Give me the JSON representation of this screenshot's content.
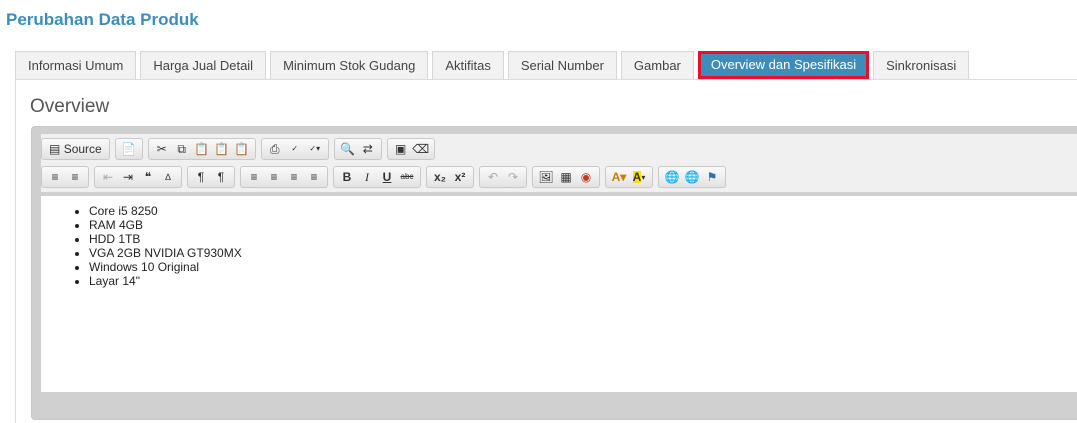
{
  "page": {
    "title": "Perubahan Data Produk"
  },
  "tabs": [
    {
      "label": "Informasi Umum",
      "active": false
    },
    {
      "label": "Harga Jual Detail",
      "active": false
    },
    {
      "label": "Minimum Stok Gudang",
      "active": false
    },
    {
      "label": "Aktifitas",
      "active": false
    },
    {
      "label": "Serial Number",
      "active": false
    },
    {
      "label": "Gambar",
      "active": false
    },
    {
      "label": "Overview dan Spesifikasi",
      "active": true
    },
    {
      "label": "Sinkronisasi",
      "active": false
    }
  ],
  "section": {
    "title": "Overview"
  },
  "editor": {
    "toolbar": {
      "source_label": "Source",
      "row1_icons": [
        "document-icon",
        "templates-icon",
        "cut-icon",
        "copy-icon",
        "paste-icon",
        "paste-text-icon",
        "paste-word-icon",
        "print-icon",
        "spellcheck-icon",
        "spellcheck-dropdown-icon",
        "find-icon",
        "replace-icon",
        "select-all-icon",
        "remove-format-icon"
      ],
      "row2_icons": [
        "numbered-list-icon",
        "bulleted-list-icon",
        "outdent-icon",
        "indent-icon",
        "blockquote-icon",
        "div-icon",
        "ltr-icon",
        "rtl-icon",
        "align-left-icon",
        "align-center-icon",
        "align-right-icon",
        "justify-icon",
        "bold-icon",
        "italic-icon",
        "underline-icon",
        "strike-icon",
        "subscript-icon",
        "superscript-icon",
        "undo-icon",
        "redo-icon",
        "image-icon",
        "flash-icon",
        "table-icon",
        "text-color-icon",
        "bg-color-icon",
        "link-icon",
        "unlink-icon",
        "anchor-icon"
      ]
    },
    "content": {
      "items": [
        "Core i5 8250",
        "RAM 4GB",
        "HDD 1TB",
        "VGA 2GB NVIDIA GT930MX",
        "Windows 10 Original",
        "Layar 14\""
      ]
    }
  },
  "colors": {
    "accent": "#3c8dbc",
    "highlight_border": "#e8102a"
  }
}
